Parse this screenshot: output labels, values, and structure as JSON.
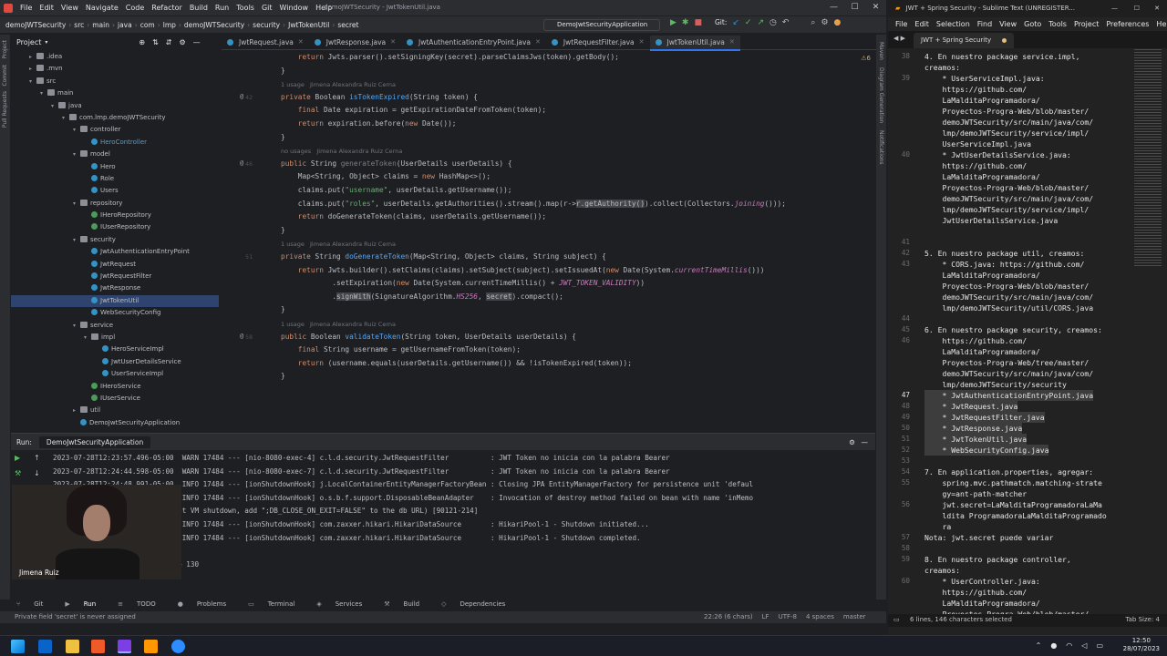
{
  "ide": {
    "window_title": "demoJWTSecurity - JwtTokenUtil.java",
    "menu": [
      "File",
      "Edit",
      "View",
      "Navigate",
      "Code",
      "Refactor",
      "Build",
      "Run",
      "Tools",
      "Git",
      "Window",
      "Help"
    ],
    "breadcrumb": [
      "demoJWTSecurity",
      "src",
      "main",
      "java",
      "com",
      "lmp",
      "demoJWTSecurity",
      "security",
      "JwtTokenUtil",
      "secret"
    ],
    "run_config": "DemoJwtSecurityApplication",
    "git_label": "Git:",
    "project_header": "Project",
    "tree": [
      {
        "label": ".idea",
        "indent": 2,
        "kind": "folder",
        "arrow": "▸"
      },
      {
        "label": ".mvn",
        "indent": 2,
        "kind": "folder",
        "arrow": "▸"
      },
      {
        "label": "src",
        "indent": 2,
        "kind": "folder",
        "arrow": "▾"
      },
      {
        "label": "main",
        "indent": 3,
        "kind": "folder",
        "arrow": "▾"
      },
      {
        "label": "java",
        "indent": 4,
        "kind": "folder",
        "arrow": "▾"
      },
      {
        "label": "com.lmp.demoJWTSecurity",
        "indent": 5,
        "kind": "pkg",
        "arrow": "▾"
      },
      {
        "label": "controller",
        "indent": 6,
        "kind": "pkg",
        "arrow": "▾"
      },
      {
        "label": "HeroController",
        "indent": 7,
        "kind": "cls",
        "arrow": ""
      },
      {
        "label": "model",
        "indent": 6,
        "kind": "pkg",
        "arrow": "▾"
      },
      {
        "label": "Hero",
        "indent": 7,
        "kind": "cls",
        "arrow": ""
      },
      {
        "label": "Role",
        "indent": 7,
        "kind": "cls",
        "arrow": ""
      },
      {
        "label": "Users",
        "indent": 7,
        "kind": "cls",
        "arrow": ""
      },
      {
        "label": "repository",
        "indent": 6,
        "kind": "pkg",
        "arrow": "▾"
      },
      {
        "label": "IHeroRepository",
        "indent": 7,
        "kind": "intf",
        "arrow": ""
      },
      {
        "label": "IUserRepository",
        "indent": 7,
        "kind": "intf",
        "arrow": ""
      },
      {
        "label": "security",
        "indent": 6,
        "kind": "pkg",
        "arrow": "▾"
      },
      {
        "label": "JwtAuthenticationEntryPoint",
        "indent": 7,
        "kind": "cls",
        "arrow": ""
      },
      {
        "label": "JwtRequest",
        "indent": 7,
        "kind": "cls",
        "arrow": ""
      },
      {
        "label": "JwtRequestFilter",
        "indent": 7,
        "kind": "cls",
        "arrow": ""
      },
      {
        "label": "JwtResponse",
        "indent": 7,
        "kind": "cls",
        "arrow": ""
      },
      {
        "label": "JwtTokenUtil",
        "indent": 7,
        "kind": "cls",
        "arrow": "",
        "selected": true
      },
      {
        "label": "WebSecurityConfig",
        "indent": 7,
        "kind": "cls",
        "arrow": ""
      },
      {
        "label": "service",
        "indent": 6,
        "kind": "pkg",
        "arrow": "▾"
      },
      {
        "label": "impl",
        "indent": 7,
        "kind": "pkg",
        "arrow": "▾"
      },
      {
        "label": "HeroServiceImpl",
        "indent": 8,
        "kind": "cls",
        "arrow": ""
      },
      {
        "label": "JwtUserDetailsService",
        "indent": 8,
        "kind": "cls",
        "arrow": ""
      },
      {
        "label": "UserServiceImpl",
        "indent": 8,
        "kind": "cls",
        "arrow": ""
      },
      {
        "label": "IHeroService",
        "indent": 7,
        "kind": "intf",
        "arrow": ""
      },
      {
        "label": "IUserService",
        "indent": 7,
        "kind": "intf",
        "arrow": ""
      },
      {
        "label": "util",
        "indent": 6,
        "kind": "pkg",
        "arrow": "▸"
      },
      {
        "label": "DemoJwtSecurityApplication",
        "indent": 6,
        "kind": "cls",
        "arrow": ""
      }
    ],
    "tabs": [
      {
        "label": "JwtRequest.java",
        "active": false
      },
      {
        "label": "JwtResponse.java",
        "active": false
      },
      {
        "label": "JwtAuthenticationEntryPoint.java",
        "active": false
      },
      {
        "label": "JwtRequestFilter.java",
        "active": false
      },
      {
        "label": "JwtTokenUtil.java",
        "active": true
      }
    ],
    "warnings": "⚠6",
    "code_lines": [
      {
        "ln": "",
        "hint": "",
        "html": "    <span class=\"kw\">return</span> Jwts.parser().setSigningKey(secret).parseClaimsJws(token).getBody();"
      },
      {
        "ln": "",
        "hint": "",
        "html": "}"
      },
      {
        "ln": "",
        "hint": "1 usage   Jimena Alexandra Ruiz Cerna",
        "html": ""
      },
      {
        "ln": "42",
        "hint": "",
        "html": "<span class=\"kw\">private</span> Boolean <span class=\"fn\">isTokenExpired</span>(String token) {"
      },
      {
        "ln": "",
        "hint": "",
        "html": "    <span class=\"kw\">final</span> Date expiration = getExpirationDateFromToken(token);"
      },
      {
        "ln": "",
        "hint": "",
        "html": "    <span class=\"kw\">return</span> expiration.before(<span class=\"kw\">new</span> Date());"
      },
      {
        "ln": "",
        "hint": "",
        "html": "}"
      },
      {
        "ln": "",
        "hint": "no usages   Jimena Alexandra Ruiz Cerna",
        "html": ""
      },
      {
        "ln": "46",
        "hint": "",
        "html": "<span class=\"kw\">public</span> String <span class=\"dim\">generateToken</span>(UserDetails userDetails) {"
      },
      {
        "ln": "",
        "hint": "",
        "html": "    Map&lt;String, Object&gt; claims = <span class=\"kw\">new</span> HashMap&lt;&gt;();"
      },
      {
        "ln": "",
        "hint": "",
        "html": "    claims.put(<span class=\"str\">\"username\"</span>, userDetails.getUsername());"
      },
      {
        "ln": "",
        "hint": "",
        "html": "    claims.put(<span class=\"str\">\"roles\"</span>, userDetails.getAuthorities().stream().map(r-&gt;<span class=\"hl\">r.getAuthority()</span>).collect(Collectors.<span class=\"it\">joining</span>()));"
      },
      {
        "ln": "",
        "hint": "",
        "html": "    <span class=\"kw\">return</span> doGenerateToken(claims, userDetails.getUsername());"
      },
      {
        "ln": "",
        "hint": "",
        "html": "}"
      },
      {
        "ln": "",
        "hint": "1 usage   Jimena Alexandra Ruiz Cerna",
        "html": ""
      },
      {
        "ln": "51",
        "hint": "",
        "html": "<span class=\"kw\">private</span> String <span class=\"fn\">doGenerateToken</span>(Map&lt;String, Object&gt; claims, String subject) {"
      },
      {
        "ln": "",
        "hint": "",
        "html": "    <span class=\"kw\">return</span> Jwts.builder().setClaims(claims).setSubject(subject).setIssuedAt(<span class=\"kw\">new</span> Date(System.<span class=\"it\">currentTimeMillis</span>()))"
      },
      {
        "ln": "",
        "hint": "",
        "html": "            .setExpiration(<span class=\"kw\">new</span> Date(System.currentTimeMillis() + <span class=\"it\">JWT_TOKEN_VALIDITY</span>))"
      },
      {
        "ln": "",
        "hint": "",
        "html": "            .<span class=\"hl\">signWith</span>(SignatureAlgorithm.<span class=\"it\">HS256</span>, <span class=\"hl\">secret</span>).compact();"
      },
      {
        "ln": "",
        "hint": "",
        "html": "}"
      },
      {
        "ln": "",
        "hint": "1 usage   Jimena Alexandra Ruiz Cerna",
        "html": ""
      },
      {
        "ln": "58",
        "hint": "",
        "html": "<span class=\"kw\">public</span> Boolean <span class=\"fn\">validateToken</span>(String token, UserDetails userDetails) {"
      },
      {
        "ln": "",
        "hint": "",
        "html": "    <span class=\"kw\">final</span> String username = getUsernameFromToken(token);"
      },
      {
        "ln": "",
        "hint": "",
        "html": "    <span class=\"kw\">return</span> (username.equals(userDetails.getUsername()) &amp;&amp; !isTokenExpired(token));"
      },
      {
        "ln": "",
        "hint": "",
        "html": "}"
      }
    ],
    "run": {
      "label": "Run:",
      "tab": "DemoJwtSecurityApplication",
      "console": [
        "2023-07-28T12:23:57.496-05:00  WARN 17484 --- [nio-8080-exec-4] c.l.d.security.JwtRequestFilter          : JWT Token no inicia con la palabra Bearer",
        "2023-07-28T12:24:44.598-05:00  WARN 17484 --- [nio-8080-exec-7] c.l.d.security.JwtRequestFilter          : JWT Token no inicia con la palabra Bearer",
        "2023-07-28T12:24:48.991-05:00  INFO 17484 --- [ionShutdownHook] j.LocalContainerEntityManagerFactoryBean : Closing JPA EntityManagerFactory for persistence unit 'defaul",
        "2023-07-28T12:24:48.991-05:00  INFO 17484 --- [ionShutdownHook] o.s.b.f.support.DisposableBeanAdapter    : Invocation of destroy method failed on bean with name 'inMemo",
        "(to disable automatic closing at VM shutdown, add \";DB_CLOSE_ON_EXIT=FALSE\" to the db URL) [90121-214]",
        "2023-07-28T12:24:48.992-05:00  INFO 17484 --- [ionShutdownHook] com.zaxxer.hikari.HikariDataSource       : HikariPool-1 - Shutdown initiated...",
        "2023-07-28T12:24:48.994-05:00  INFO 17484 --- [ionShutdownHook] com.zaxxer.hikari.HikariDataSource       : HikariPool-1 - Shutdown completed.",
        "",
        "Process finished with exit code 130"
      ]
    },
    "webcam_name": "Jimena Ruiz",
    "tool_windows": [
      "Git",
      "Run",
      "TODO",
      "Problems",
      "Terminal",
      "Services",
      "Build",
      "Dependencies"
    ],
    "status_left": "Private field 'secret' is never assigned",
    "status_right": [
      "22:26 (6 chars)",
      "LF",
      "UTF-8",
      "4 spaces",
      "master"
    ]
  },
  "sublime": {
    "title": "JWT + Spring Security - Sublime Text (UNREGISTER...",
    "menu": [
      "File",
      "Edit",
      "Selection",
      "Find",
      "View",
      "Goto",
      "Tools",
      "Project",
      "Preferences",
      "Help"
    ],
    "tab": "JWT + Spring Security",
    "lines": [
      {
        "n": "38",
        "t": "4. En nuestro package service.impl,"
      },
      {
        "n": "",
        "t": "creamos:"
      },
      {
        "n": "39",
        "t": "    * UserServiceImpl.java:"
      },
      {
        "n": "",
        "t": "    https://github.com/"
      },
      {
        "n": "",
        "t": "    LaMalditaProgramadora/"
      },
      {
        "n": "",
        "t": "    Proyectos-Progra-Web/blob/master/"
      },
      {
        "n": "",
        "t": "    demoJWTSecurity/src/main/java/com/"
      },
      {
        "n": "",
        "t": "    lmp/demoJWTSecurity/service/impl/"
      },
      {
        "n": "",
        "t": "    UserServiceImpl.java"
      },
      {
        "n": "40",
        "t": "    * JwtUserDetailsService.java:"
      },
      {
        "n": "",
        "t": "    https://github.com/"
      },
      {
        "n": "",
        "t": "    LaMalditaProgramadora/"
      },
      {
        "n": "",
        "t": "    Proyectos-Progra-Web/blob/master/"
      },
      {
        "n": "",
        "t": "    demoJWTSecurity/src/main/java/com/"
      },
      {
        "n": "",
        "t": "    lmp/demoJWTSecurity/service/impl/"
      },
      {
        "n": "",
        "t": "    JwtUserDetailsService.java"
      },
      {
        "n": "",
        "t": ""
      },
      {
        "n": "41",
        "t": ""
      },
      {
        "n": "42",
        "t": "5. En nuestro package util, creamos:"
      },
      {
        "n": "43",
        "t": "    * CORS.java: https://github.com/"
      },
      {
        "n": "",
        "t": "    LaMalditaProgramadora/"
      },
      {
        "n": "",
        "t": "    Proyectos-Progra-Web/blob/master/"
      },
      {
        "n": "",
        "t": "    demoJWTSecurity/src/main/java/com/"
      },
      {
        "n": "",
        "t": "    lmp/demoJWTSecurity/util/CORS.java"
      },
      {
        "n": "44",
        "t": ""
      },
      {
        "n": "45",
        "t": "6. En nuestro package security, creamos:"
      },
      {
        "n": "46",
        "t": "    https://github.com/"
      },
      {
        "n": "",
        "t": "    LaMalditaProgramadora/"
      },
      {
        "n": "",
        "t": "    Proyectos-Progra-Web/tree/master/"
      },
      {
        "n": "",
        "t": "    demoJWTSecurity/src/main/java/com/"
      },
      {
        "n": "",
        "t": "    lmp/demoJWTSecurity/security"
      },
      {
        "n": "47",
        "t": "    * JwtAuthenticationEntryPoint.java",
        "cur": true,
        "sel": true
      },
      {
        "n": "48",
        "t": "    * JwtRequest.java",
        "sel": true
      },
      {
        "n": "49",
        "t": "    * JwtRequestFilter.java",
        "sel": true
      },
      {
        "n": "50",
        "t": "    * JwtResponse.java",
        "sel": true
      },
      {
        "n": "51",
        "t": "    * JwtTokenUtil.java",
        "sel": true
      },
      {
        "n": "52",
        "t": "    * WebSecurityConfig.java",
        "sel": true
      },
      {
        "n": "53",
        "t": ""
      },
      {
        "n": "54",
        "t": "7. En application.properties, agregar:"
      },
      {
        "n": "55",
        "t": "    spring.mvc.pathmatch.matching-strate"
      },
      {
        "n": "",
        "t": "    gy=ant-path-matcher"
      },
      {
        "n": "56",
        "t": "    jwt.secret=LaMalditaProgramadoraLaMa"
      },
      {
        "n": "",
        "t": "    ldita ProgramadoraLaMalditaProgramado"
      },
      {
        "n": "",
        "t": "    ra"
      },
      {
        "n": "57",
        "t": "Nota: jwt.secret puede variar"
      },
      {
        "n": "58",
        "t": ""
      },
      {
        "n": "59",
        "t": "8. En nuestro package controller,"
      },
      {
        "n": "",
        "t": "creamos:"
      },
      {
        "n": "60",
        "t": "    * UserController.java:"
      },
      {
        "n": "",
        "t": "    https://github.com/"
      },
      {
        "n": "",
        "t": "    LaMalditaProgramadora/"
      },
      {
        "n": "",
        "t": "    Proyectos-Progra-Web/blob/master/"
      },
      {
        "n": "",
        "t": "    demoJWTSecurity/src/main/java/com/"
      }
    ],
    "status_left": "6 lines, 146 characters selected",
    "status_right": "Tab Size: 4"
  },
  "taskbar": {
    "time": "12:50",
    "date": "28/07/2023"
  }
}
